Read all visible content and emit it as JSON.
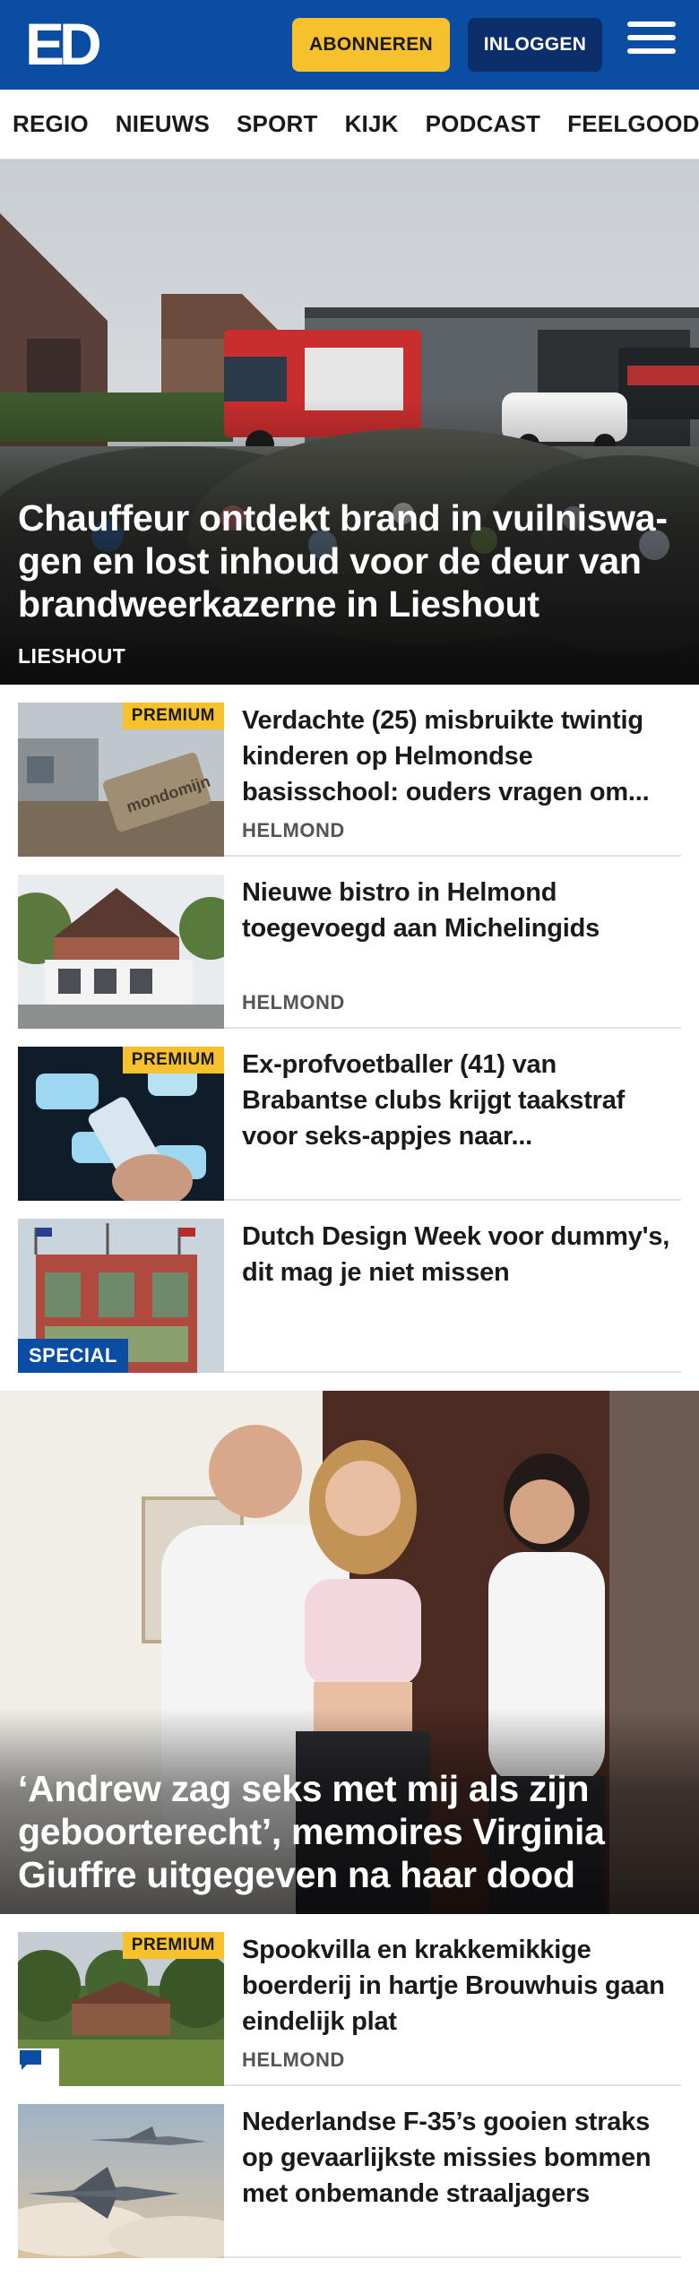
{
  "header": {
    "logo_text": "ED",
    "subscribe_label": "ABONNEREN",
    "login_label": "INLOGGEN",
    "menu_icon": "hamburger-menu-icon",
    "colors": {
      "brand_blue": "#0a4da2",
      "dark_blue": "#0b2f6b",
      "accent_yellow": "#f7c12e"
    }
  },
  "nav": {
    "items": [
      "REGIO",
      "NIEUWS",
      "SPORT",
      "KIJK",
      "PODCAST",
      "FEELGOOD"
    ]
  },
  "hero": {
    "title": "Chauffeur ontdekt brand in vuilniswa­gen en lost inhoud voor de deur van brandweerkazerne in Lieshout",
    "location": "LIESHOUT"
  },
  "articles": [
    {
      "title": "Verdachte (25) misbruikte twintig kinderen op Helmondse basisschool: ouders vragen om...",
      "location": "HELMOND",
      "badge": "PREMIUM"
    },
    {
      "title": "Nieuwe bistro in Helmond toegevoegd aan Michelingids",
      "location": "HELMOND",
      "badge": ""
    },
    {
      "title": "Ex-profvoetballer (41) van Brabantse clubs krijgt taakstraf voor seks-appjes naar...",
      "location": "",
      "badge": "PREMIUM"
    },
    {
      "title": "Dutch Design Week voor dummy's, dit mag je niet missen",
      "location": "",
      "badge": "SPECIAL"
    }
  ],
  "feature": {
    "title": "‘Andrew zag seks met mij als zijn geboorterecht’, memoires Virginia Giuffre uitgegeven na haar dood"
  },
  "articles2": [
    {
      "title": "Spookvilla en krakkemikkige boerderij in hartje Brouwhuis gaan eindelijk plat",
      "location": "HELMOND",
      "badge": "PREMIUM",
      "icon": "comment-icon"
    },
    {
      "title": "Nederlandse F-35’s gooien straks op gevaarlijkste missies bommen met onbemande straaljagers",
      "location": "",
      "badge": ""
    }
  ]
}
